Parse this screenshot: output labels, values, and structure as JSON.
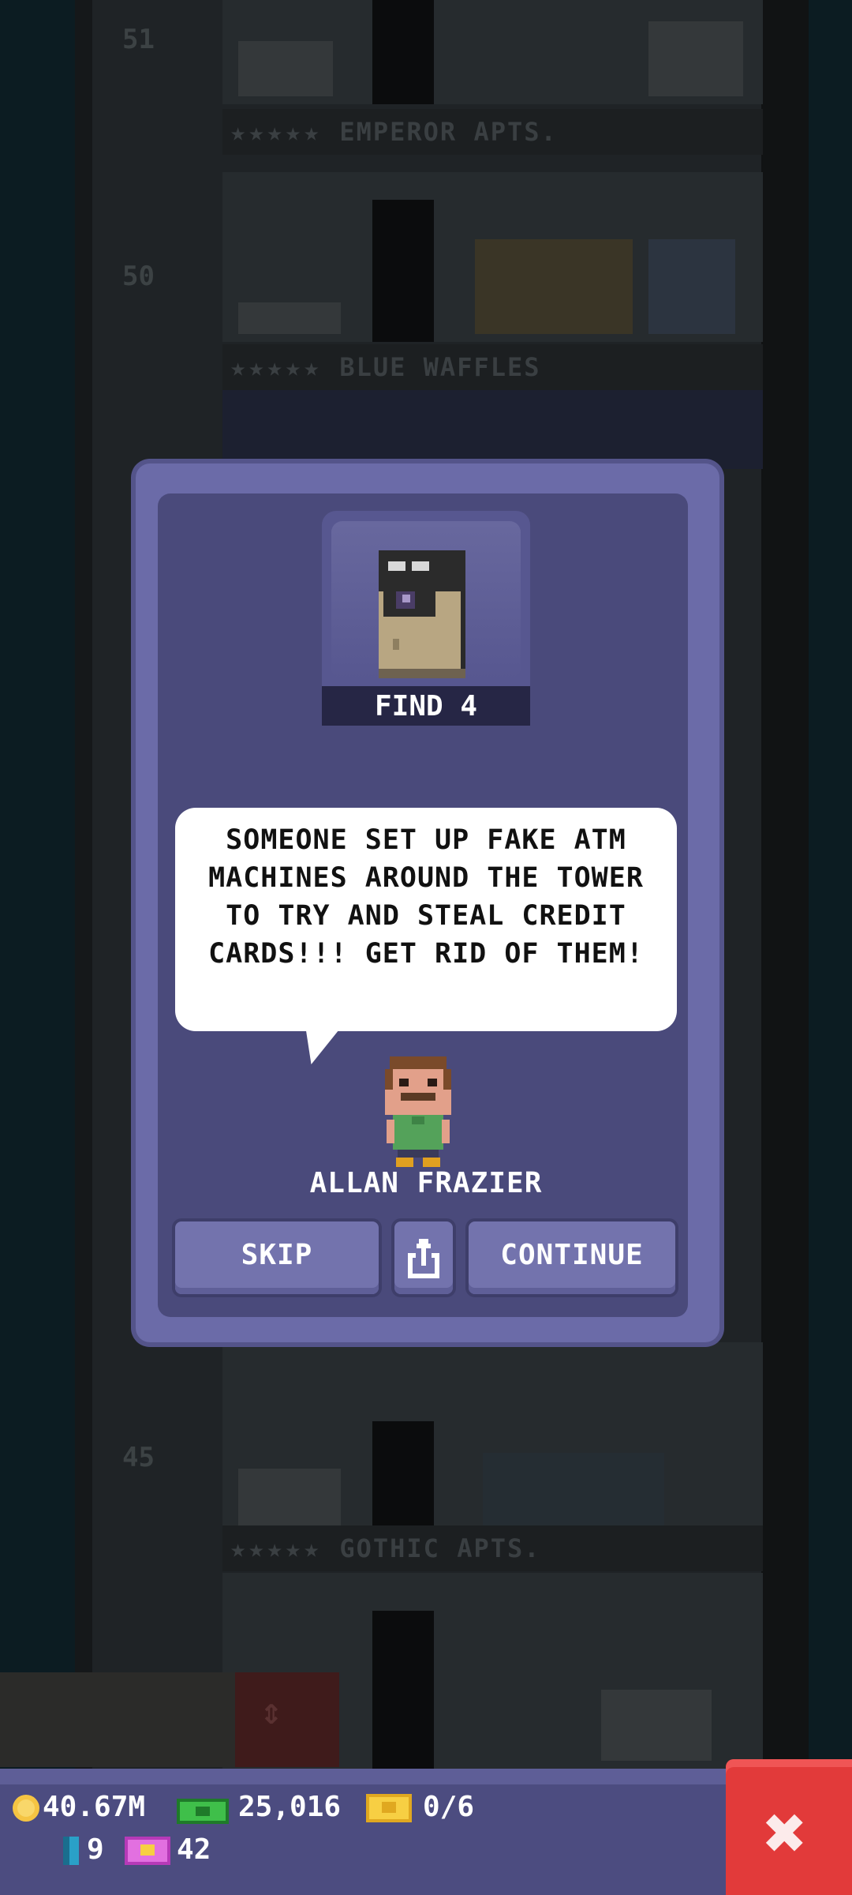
{
  "colors": {
    "dialog": "#6b6ba8",
    "dialog_inner": "#4a4a7b",
    "button": "#7373ad",
    "close_button": "#e23a3a",
    "hud": "#4c4c80"
  },
  "tower": {
    "floor_numbers": [
      "51",
      "50",
      "45"
    ],
    "floor_labels": [
      "EMPEROR APTS.",
      "BLUE WAFFLES",
      "GOTHIC APTS."
    ],
    "stars": "★★★★★"
  },
  "mission": {
    "icon": "atm-machine-icon",
    "find_label": "FIND 4",
    "message": "SOMEONE SET UP FAKE ATM MACHINES AROUND THE TOWER TO TRY AND STEAL CREDIT CARDS!!! GET RID OF THEM!",
    "character_name": "ALLAN FRAZIER"
  },
  "buttons": {
    "skip": "SKIP",
    "share_icon": "share-icon",
    "continue": "CONTINUE"
  },
  "hud": {
    "coins": "40.67M",
    "bux": "25,016",
    "tickets": "0/6",
    "elevator_count": "9",
    "vip": "42",
    "close_icon": "close-icon"
  }
}
